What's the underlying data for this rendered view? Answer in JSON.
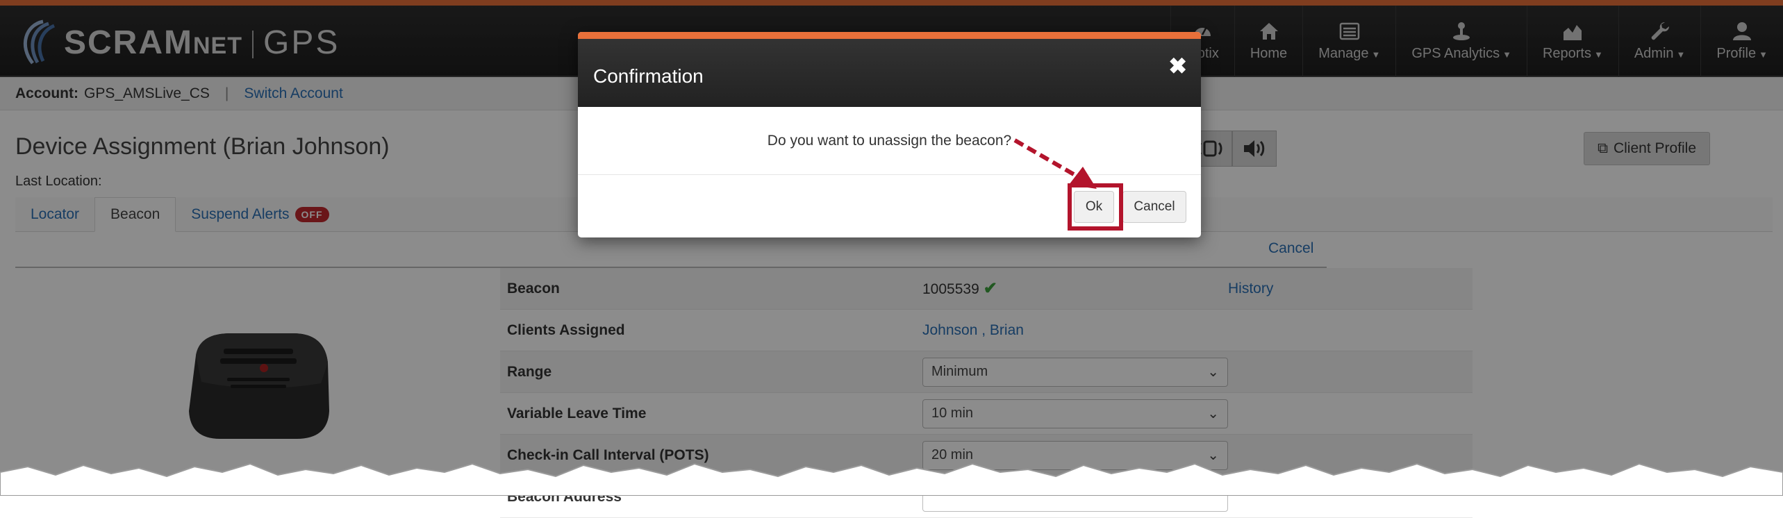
{
  "brand": {
    "name": "SCRAM",
    "suffix": "NET",
    "product": "GPS"
  },
  "nav": {
    "items": [
      {
        "label": "Optix",
        "icon": "dashboard-icon",
        "caret": false
      },
      {
        "label": "Home",
        "icon": "home-icon",
        "caret": false
      },
      {
        "label": "Manage",
        "icon": "list-icon",
        "caret": true
      },
      {
        "label": "GPS Analytics",
        "icon": "joystick-icon",
        "caret": true
      },
      {
        "label": "Reports",
        "icon": "area-chart-icon",
        "caret": true
      },
      {
        "label": "Admin",
        "icon": "wrench-icon",
        "caret": true
      },
      {
        "label": "Profile",
        "icon": "user-icon",
        "caret": true
      }
    ]
  },
  "account": {
    "label": "Account:",
    "value": "GPS_AMSLive_CS",
    "switch_label": "Switch Account"
  },
  "page": {
    "title": "Device Assignment (Brian Johnson)",
    "last_location_label": "Last Location:",
    "client_profile_label": "Client Profile",
    "cancel_label": "Cancel"
  },
  "tabs": [
    {
      "label": "Locator",
      "active": false
    },
    {
      "label": "Beacon",
      "active": true
    },
    {
      "label": "Suspend Alerts",
      "active": false,
      "badge": "OFF"
    }
  ],
  "beacon": {
    "rows": {
      "beacon": {
        "label": "Beacon",
        "value": "1005539",
        "history_label": "History"
      },
      "clients": {
        "label": "Clients Assigned",
        "value": "Johnson , Brian"
      },
      "range": {
        "label": "Range",
        "value": "Minimum"
      },
      "leave": {
        "label": "Variable Leave Time",
        "value": "10 min"
      },
      "checkin": {
        "label": "Check-in Call Interval (POTS)",
        "value": "20 min"
      },
      "address": {
        "label": "Beacon Address"
      }
    }
  },
  "modal": {
    "title": "Confirmation",
    "message": "Do you want to unassign the beacon?",
    "ok_label": "Ok",
    "cancel_label": "Cancel"
  },
  "colors": {
    "accent": "#e8703a",
    "link": "#2a6fb5",
    "callout": "#b3142c",
    "badge": "#c1282e"
  }
}
